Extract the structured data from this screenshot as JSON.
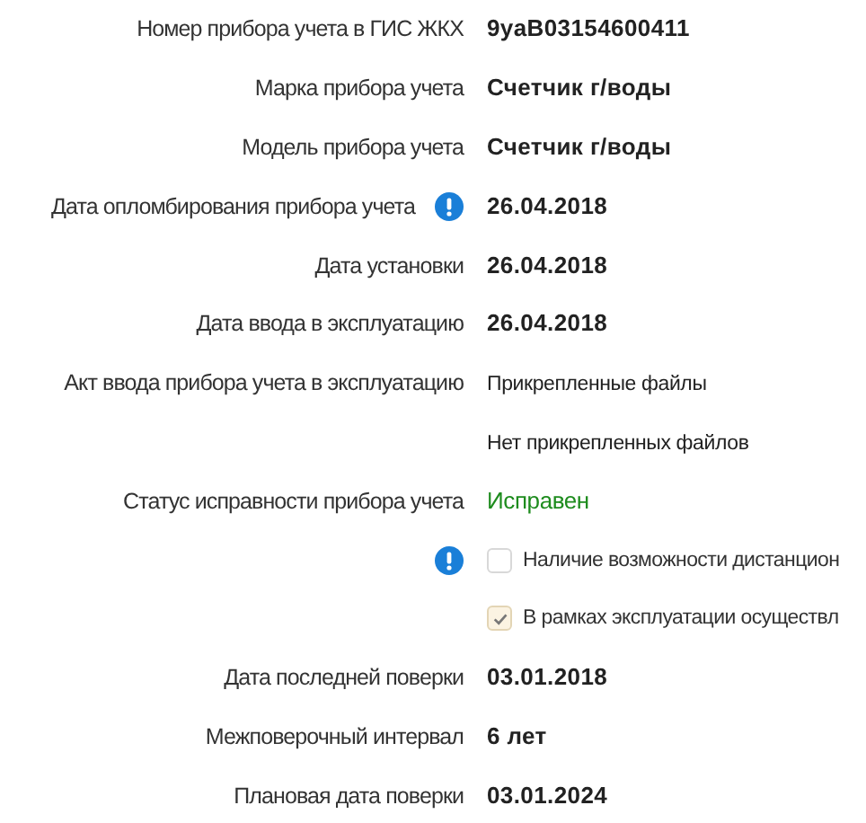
{
  "rows": [
    {
      "kind": "field",
      "label": "Номер прибора учета в ГИС ЖКХ",
      "value": "9yaB03154600411",
      "info": false
    },
    {
      "kind": "field",
      "label": "Марка прибора учета",
      "value": "Счетчик г/воды",
      "info": false
    },
    {
      "kind": "field",
      "label": "Модель прибора учета",
      "value": "Счетчик г/воды",
      "info": false
    },
    {
      "kind": "field",
      "label": "Дата опломбирования прибора учета",
      "value": "26.04.2018",
      "info": true
    },
    {
      "kind": "field",
      "label": "Дата установки",
      "value": "26.04.2018",
      "info": false
    },
    {
      "kind": "field",
      "label": "Дата ввода в эксплуатацию",
      "value": "26.04.2018",
      "info": false
    },
    {
      "kind": "files",
      "label": "Акт ввода прибора учета в эксплуатацию",
      "value": "Прикрепленные файлы",
      "note": "Нет прикрепленных файлов",
      "info": false
    },
    {
      "kind": "status",
      "label": "Статус исправности прибора учета",
      "value": "Исправен",
      "info": false
    },
    {
      "kind": "checkbox",
      "text": "Наличие возможности дистанцион",
      "checked": false,
      "info": true
    },
    {
      "kind": "checkbox",
      "text": "В рамках эксплуатации осуществл",
      "checked": true,
      "info": false
    },
    {
      "kind": "field",
      "label": "Дата последней поверки",
      "value": "03.01.2018",
      "info": false
    },
    {
      "kind": "field",
      "label": "Межповерочный интервал",
      "value": "6 лет",
      "info": false
    },
    {
      "kind": "field",
      "label": "Плановая дата поверки",
      "value": "03.01.2024",
      "info": false
    }
  ]
}
